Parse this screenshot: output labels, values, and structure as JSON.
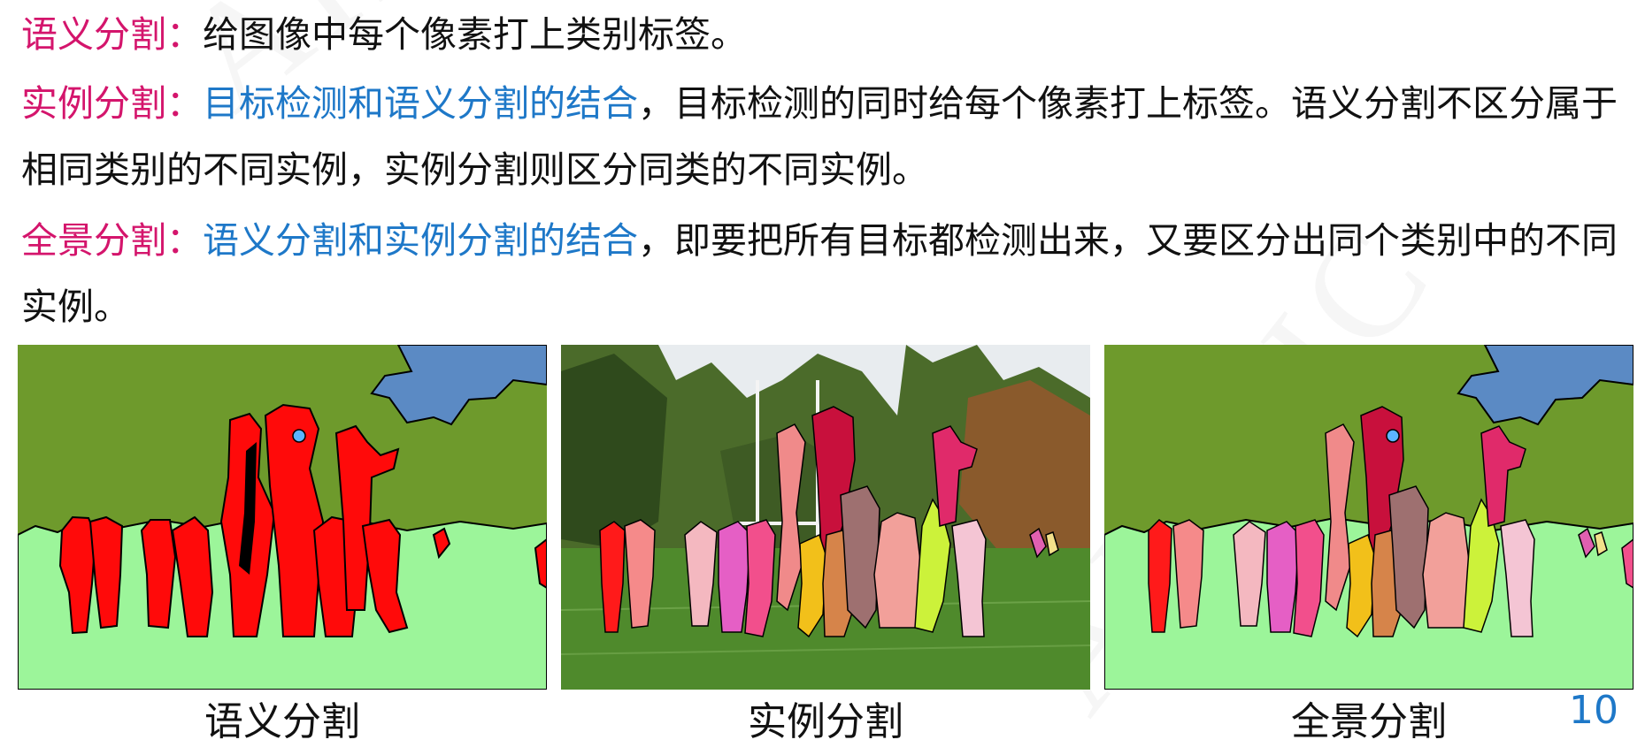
{
  "watermark": "AIRVIC",
  "definitions": [
    {
      "term": "语义分割：",
      "highlight": "",
      "text": "给图像中每个像素打上类别标签。"
    },
    {
      "term": "实例分割：",
      "highlight": "目标检测和语义分割的结合",
      "text": "，目标检测的同时给每个像素打上标签。语义分割不区分属于相同类别的不同实例，实例分割则区分同类的不同实例。"
    },
    {
      "term": "全景分割：",
      "highlight": "语义分割和实例分割的结合",
      "text": "，即要把所有目标都检测出来，又要区分出同个类别中的不同实例。"
    }
  ],
  "figures": [
    {
      "caption": "语义分割",
      "kind": "semantic"
    },
    {
      "caption": "实例分割",
      "kind": "instance"
    },
    {
      "caption": "全景分割",
      "kind": "panoptic"
    }
  ],
  "colors": {
    "term": "#d4156c",
    "highlight": "#1e78c8",
    "grass_label": "#9cf59a",
    "background_label": "#6e9a2c",
    "sky_label": "#5b8ac4",
    "person_semantic": "#ff0a0a"
  },
  "page_number": "10"
}
